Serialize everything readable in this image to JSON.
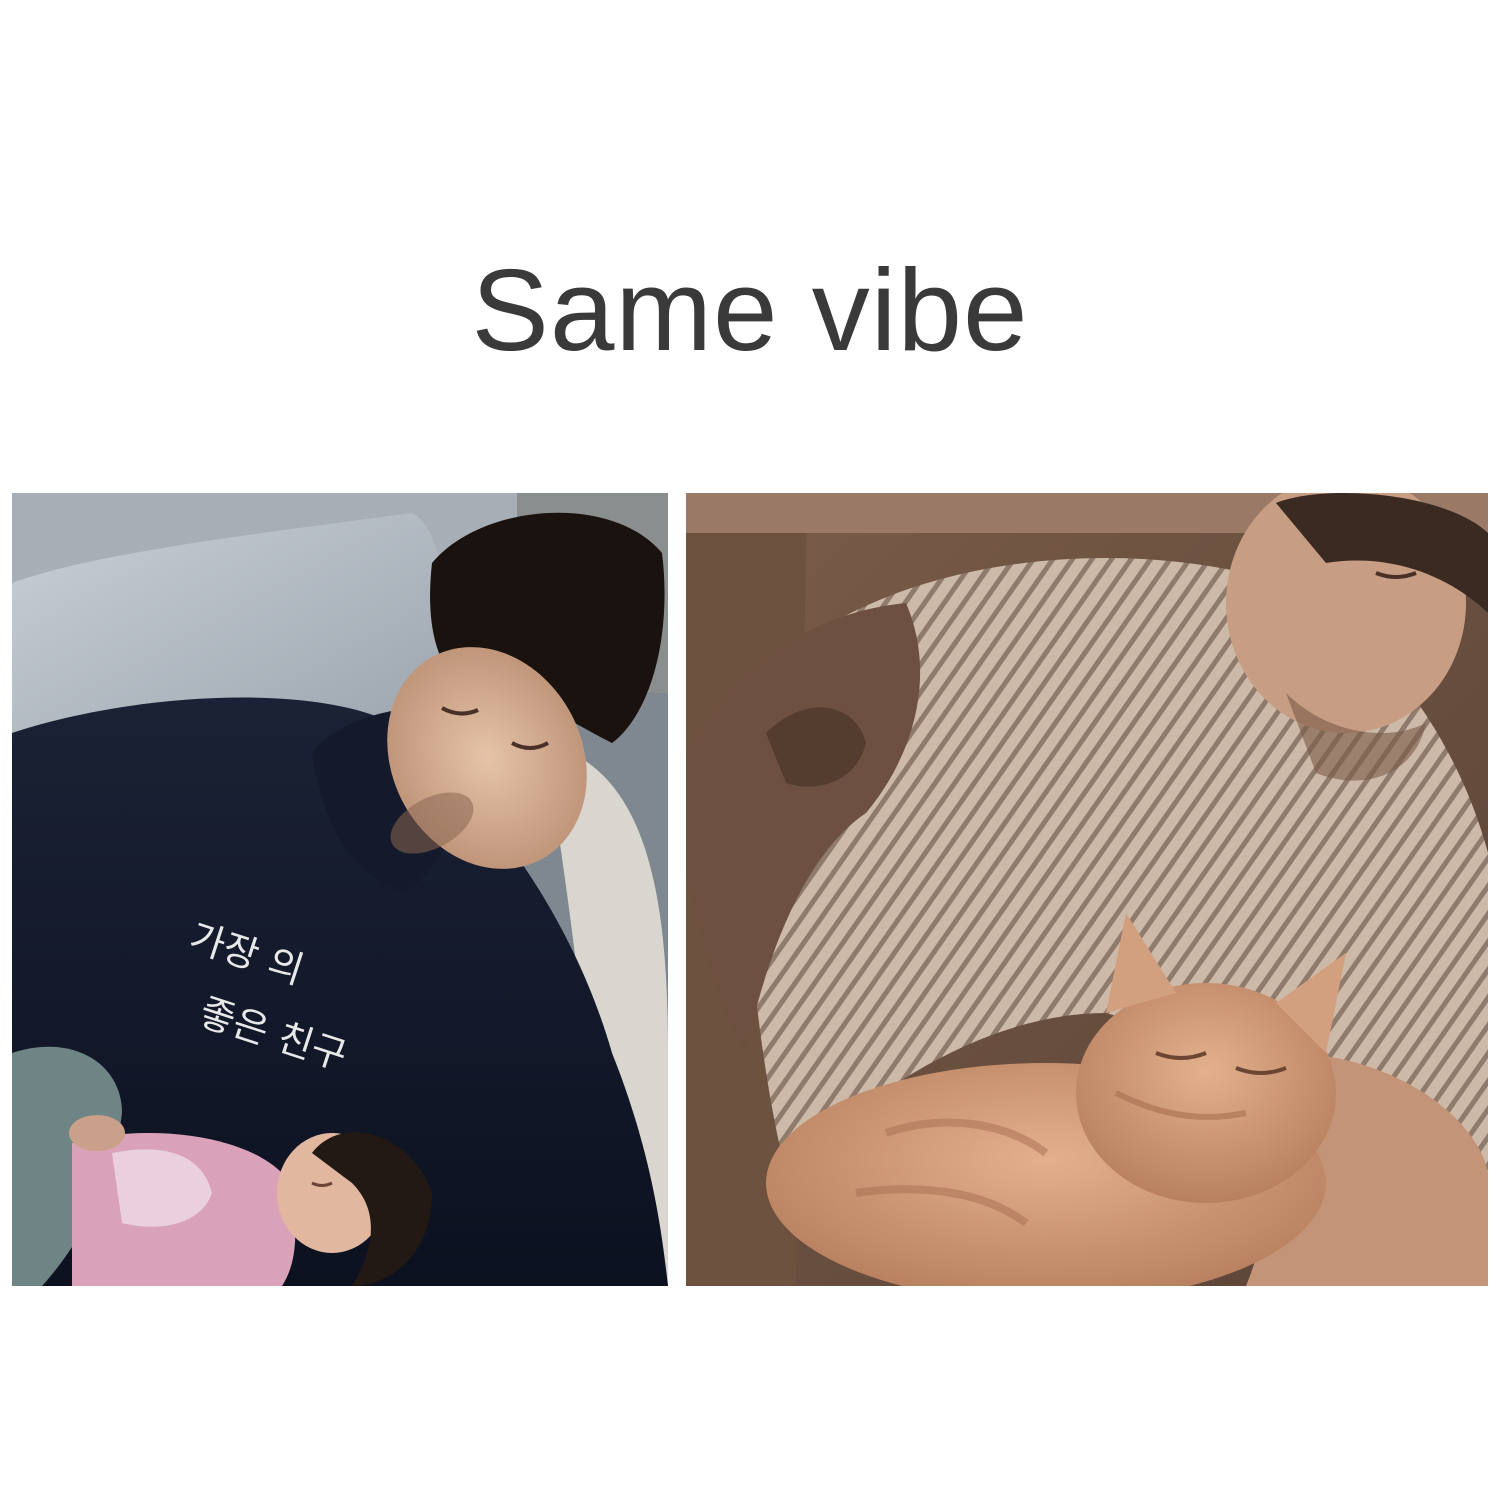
{
  "caption": {
    "text": "Same vibe"
  },
  "photos": {
    "left": {
      "hoodie_text_line1": "가장 의",
      "hoodie_text_line2": "좋은 친구"
    },
    "right": {}
  },
  "colors": {
    "background": "#ffffff",
    "caption_text": "#3a3a3a"
  }
}
